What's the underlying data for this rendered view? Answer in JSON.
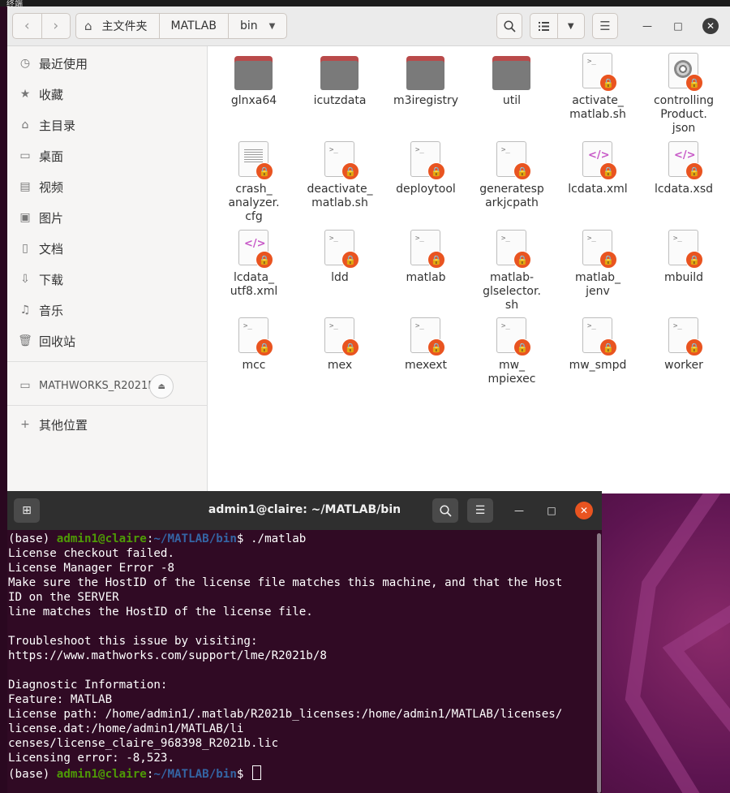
{
  "desktop": {
    "top_panel_text": "终端"
  },
  "file_manager": {
    "breadcrumbs": [
      "主文件夹",
      "MATLAB",
      "bin"
    ],
    "sidebar": {
      "places": [
        {
          "label": "最近使用",
          "icon": "clock-icon"
        },
        {
          "label": "收藏",
          "icon": "star-icon"
        },
        {
          "label": "主目录",
          "icon": "home-icon"
        },
        {
          "label": "桌面",
          "icon": "desktop-icon"
        },
        {
          "label": "视频",
          "icon": "video-icon"
        },
        {
          "label": "图片",
          "icon": "image-icon"
        },
        {
          "label": "文档",
          "icon": "document-icon"
        },
        {
          "label": "下载",
          "icon": "download-icon"
        },
        {
          "label": "音乐",
          "icon": "music-icon"
        },
        {
          "label": "回收站",
          "icon": "trash-icon"
        }
      ],
      "device": {
        "label": "MATHWORKS_R2021B",
        "icon": "drive-icon"
      },
      "other": {
        "label": "其他位置",
        "icon": "plus-icon"
      }
    },
    "files": [
      {
        "name": "glnxa64",
        "type": "folder"
      },
      {
        "name": "icutzdata",
        "type": "folder"
      },
      {
        "name": "m3iregistry",
        "type": "folder"
      },
      {
        "name": "util",
        "type": "folder"
      },
      {
        "name": "activate_\nmatlab.sh",
        "type": "script"
      },
      {
        "name": "controlling\nProduct.\njson",
        "type": "disc"
      },
      {
        "name": "crash_\nanalyzer.\ncfg",
        "type": "text"
      },
      {
        "name": "deactivate_\nmatlab.sh",
        "type": "script"
      },
      {
        "name": "deploytool",
        "type": "script"
      },
      {
        "name": "generatesp\narkjcpath",
        "type": "script"
      },
      {
        "name": "lcdata.xml",
        "type": "xml"
      },
      {
        "name": "lcdata.xsd",
        "type": "xml"
      },
      {
        "name": "lcdata_\nutf8.xml",
        "type": "xml"
      },
      {
        "name": "ldd",
        "type": "script"
      },
      {
        "name": "matlab",
        "type": "script"
      },
      {
        "name": "matlab-\nglselector.\nsh",
        "type": "script"
      },
      {
        "name": "matlab_\njenv",
        "type": "script"
      },
      {
        "name": "mbuild",
        "type": "script"
      },
      {
        "name": "mcc",
        "type": "script"
      },
      {
        "name": "mex",
        "type": "script"
      },
      {
        "name": "mexext",
        "type": "script"
      },
      {
        "name": "mw_\nmpiexec",
        "type": "script"
      },
      {
        "name": "mw_smpd",
        "type": "script"
      },
      {
        "name": "worker",
        "type": "script"
      }
    ]
  },
  "terminal": {
    "title": "admin1@claire: ~/MATLAB/bin",
    "prompt": {
      "env": "(base) ",
      "user": "admin1@claire",
      "sep": ":",
      "path": "~/MATLAB/bin",
      "end": "$ "
    },
    "command": "./matlab",
    "output": [
      "License checkout failed.",
      "License Manager Error -8",
      "Make sure the HostID of the license file matches this machine, and that the HostID on the SERVER",
      "line matches the HostID of the license file.",
      "",
      "Troubleshoot this issue by visiting:",
      "https://www.mathworks.com/support/lme/R2021b/8",
      "",
      "Diagnostic Information:",
      "Feature: MATLAB",
      "License path: /home/admin1/.matlab/R2021b_licenses:/home/admin1/MATLAB/licenses/license.dat:/home/admin1/MATLAB/licenses/license_claire_968398_R2021b.lic",
      "Licensing error: -8,523."
    ],
    "output_wrapped": [
      "License checkout failed.",
      "License Manager Error -8",
      "Make sure the HostID of the license file matches this machine, and that the Host",
      "ID on the SERVER",
      "line matches the HostID of the license file.",
      "",
      "Troubleshoot this issue by visiting:",
      "https://www.mathworks.com/support/lme/R2021b/8",
      "",
      "Diagnostic Information:",
      "Feature: MATLAB",
      "License path: /home/admin1/.matlab/R2021b_licenses:/home/admin1/MATLAB/licenses/",
      "license.dat:/home/admin1/MATLAB/li",
      "censes/license_claire_968398_R2021b.lic",
      "Licensing error: -8,523."
    ]
  },
  "colors": {
    "accent": "#e95420",
    "terminal_bg": "#300a24",
    "prompt_user": "#4e9a06",
    "prompt_path": "#3465a4"
  }
}
